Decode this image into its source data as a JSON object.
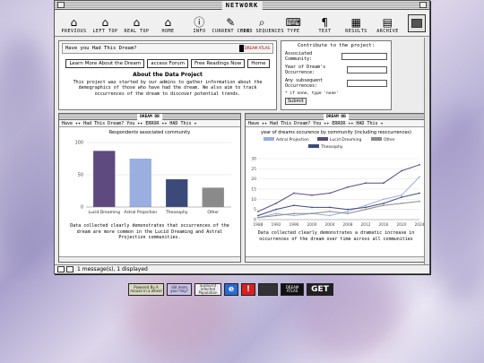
{
  "window": {
    "title": "NETWORK"
  },
  "toolbar": [
    {
      "label": "PREVIOUS",
      "icon": "⌂"
    },
    {
      "label": "LEFT TOP",
      "icon": "⌂"
    },
    {
      "label": "REAL TOP",
      "icon": "⌂"
    },
    {
      "label": "HOME",
      "icon": "⌂"
    },
    {
      "label": "INFO",
      "icon": "ⓘ"
    },
    {
      "label": "CURRENT CODE",
      "icon": "✎"
    },
    {
      "label": "FIND SEQUENCES",
      "icon": "⌕"
    },
    {
      "label": "TYPE",
      "icon": "⌨"
    },
    {
      "label": "TEXT",
      "icon": "¶"
    },
    {
      "label": "RESULTS",
      "icon": "▦"
    },
    {
      "label": "ARCHIVE",
      "icon": "▤"
    }
  ],
  "question": {
    "text": "Have you Had This Dream?",
    "logo_text": "DREAM ATLAS"
  },
  "links": [
    "Learn More About the Dream",
    "access Forum",
    "Free Readings Now",
    "Home"
  ],
  "about": {
    "title": "About the Data Project",
    "body": "This project was started by our admins to gather information about the demographics of those who have had the dream. We also aim to track occurrences of the dream to discover potential trends."
  },
  "contribute": {
    "title": "Contribute to the project:",
    "fields": [
      "Associated Community:",
      "Year of Dream's Occurrence:",
      "Any subsequent Occurrences:"
    ],
    "note": "* if none, type 'none'",
    "submit": "Submit"
  },
  "left_panel": {
    "window_title": "DREAM DB",
    "header": "Have ✦✦ Had This Dream? You  ✦✦ ERROR  ✦✦ HAD This ✦",
    "caption": "Data collected clearly demonstrates that occurrences of the dream are more common in the Lucid Dreaming and Astral Projection communities."
  },
  "right_panel": {
    "window_title": "DREAM DB",
    "header": "Have ✦✦ Had This Dream? You  ✦✦ ERROR  ✦✦ HAD This ✦",
    "caption": "Data collected clearly demonstrates a dramatic increase in occurrences of the dream over time across all communities"
  },
  "status": {
    "text": "1 message(s), 1 displayed"
  },
  "badges": [
    {
      "text": "Powered By A mouse in a wheel",
      "bg": "#d8d8c0",
      "w": 40
    },
    {
      "text": "did mom you! hey?",
      "bg": "#c8c0e8",
      "w": 28
    },
    {
      "text": "Sunburnt Infected Population",
      "bg": "#f0f0f0",
      "w": 30
    },
    {
      "text": "e",
      "bg": "#2a6ad8",
      "w": 16
    },
    {
      "text": "!",
      "bg": "#d82020",
      "w": 16
    },
    {
      "text": "",
      "bg": "#333333",
      "w": 22
    },
    {
      "text": "DREAM ATLAS",
      "bg": "#111111",
      "w": 26
    },
    {
      "text": "GET",
      "bg": "#222222",
      "w": 30
    }
  ],
  "chart_data": [
    {
      "type": "bar",
      "title": "Respondents associated community",
      "categories": [
        "Lucid Dreaming",
        "Astral Projection",
        "Theosophy",
        "Other"
      ],
      "values": [
        87,
        75,
        43,
        30
      ],
      "colors": [
        "#5e4a7e",
        "#9aaee0",
        "#3c4a7a",
        "#8a8a8a"
      ],
      "ylim": [
        0,
        100
      ],
      "yticks": [
        0,
        50,
        100
      ],
      "grid": true
    },
    {
      "type": "line",
      "title": "year of dreams occurence by community (including reoccurrences)",
      "x": [
        1988,
        1992,
        1996,
        2000,
        2004,
        2008,
        2012,
        2016,
        2020,
        2024
      ],
      "ylim": [
        0,
        30
      ],
      "yticks": [
        0,
        5,
        10,
        15,
        20,
        25,
        30
      ],
      "legend": "top",
      "series": [
        {
          "name": "Astral Projection",
          "color": "#9aaee0",
          "values": [
            1,
            3,
            2,
            3,
            2,
            4,
            7,
            10,
            12,
            21
          ]
        },
        {
          "name": "Lucid Dreaming",
          "color": "#5e4a7e",
          "values": [
            4,
            8,
            13,
            12,
            13,
            16,
            18,
            18,
            24,
            27
          ]
        },
        {
          "name": "Other",
          "color": "#8a8a8a",
          "values": [
            1,
            2,
            3,
            3,
            4,
            3,
            5,
            7,
            8,
            9
          ]
        },
        {
          "name": "Theosophy",
          "color": "#3c4a7a",
          "values": [
            2,
            5,
            7,
            6,
            6,
            5,
            6,
            8,
            11,
            13
          ]
        }
      ]
    }
  ]
}
